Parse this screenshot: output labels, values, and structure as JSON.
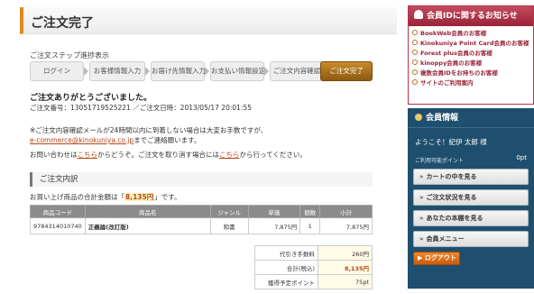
{
  "header": {
    "title": "ご注文完了"
  },
  "steps": {
    "label": "ご注文ステップ進捗表示",
    "items": [
      "ログイン",
      "お客様情報入力",
      "お届け先情報入力",
      "お支払い情報設定",
      "ご注文内容確認",
      "ご注文完了"
    ],
    "active_index": 5
  },
  "confirmation": {
    "thanks": "ご注文ありがとうございました。",
    "order_info": "ご注文番号：13051719525221 ／ご注文日時：2013/05/17 20:01:55",
    "notice1": "※ご注文内容確認メールが24時間以内に到着しない場合は大変お手数ですが、",
    "email": "e-commerce@kinokuniya.co.jp",
    "notice2_suffix": "までご連絡願います。",
    "inquiry_prefix": "お問い合わせは",
    "inquiry_link": "こちら",
    "inquiry_mid": "からどうぞ。ご注文を取り消す場合には",
    "cancel_link": "こちら",
    "inquiry_suffix": "から行ってください。"
  },
  "order_details": {
    "title": "ご注文内訳",
    "total_prefix": "お買い上げ商品の合計金額は「",
    "total_amount": "8,135円",
    "total_suffix": "」です。",
    "columns": [
      "商品コード",
      "商品名",
      "ジャンル",
      "単価",
      "個数",
      "小計"
    ],
    "rows": [
      {
        "code": "9784314010740",
        "name": "正義論(改訂版)",
        "genre": "和書",
        "price": "7,875円",
        "qty": "1",
        "subtotal": "7,875円"
      }
    ],
    "summary": [
      {
        "label": "代引き手数料",
        "value": "260円"
      },
      {
        "label": "合計(税込)",
        "value": "8,135円"
      },
      {
        "label": "獲得予定ポイント",
        "value": "75pt"
      }
    ]
  },
  "sidebar": {
    "notice_title": "会員IDに関するお知らせ",
    "notice_items": [
      "BookWeb会員のお客様",
      "Kinokuniya Point Card会員のお客様",
      "Forest plus会員のお客様",
      "kinoppy会員のお客様",
      "複数会員IDをお持ちのお客様",
      "サイトのご利用案内"
    ],
    "member_title": "会員情報",
    "welcome": "ようこそ！紀伊 太郎 様",
    "points_label": "ご利用可能ポイント",
    "points_value": "0pt",
    "menu": [
      "カートの中を見る",
      "ご注文状況を見る",
      "あなたの本棚を見る",
      "会員メニュー"
    ],
    "logout": "ログアウト"
  },
  "colors": {
    "accent": "#e08a1e",
    "active_step": "#a86e1c",
    "brand_red": "#9a2337",
    "member_blue": "#1f4f6e",
    "highlight": "#b4481a"
  }
}
